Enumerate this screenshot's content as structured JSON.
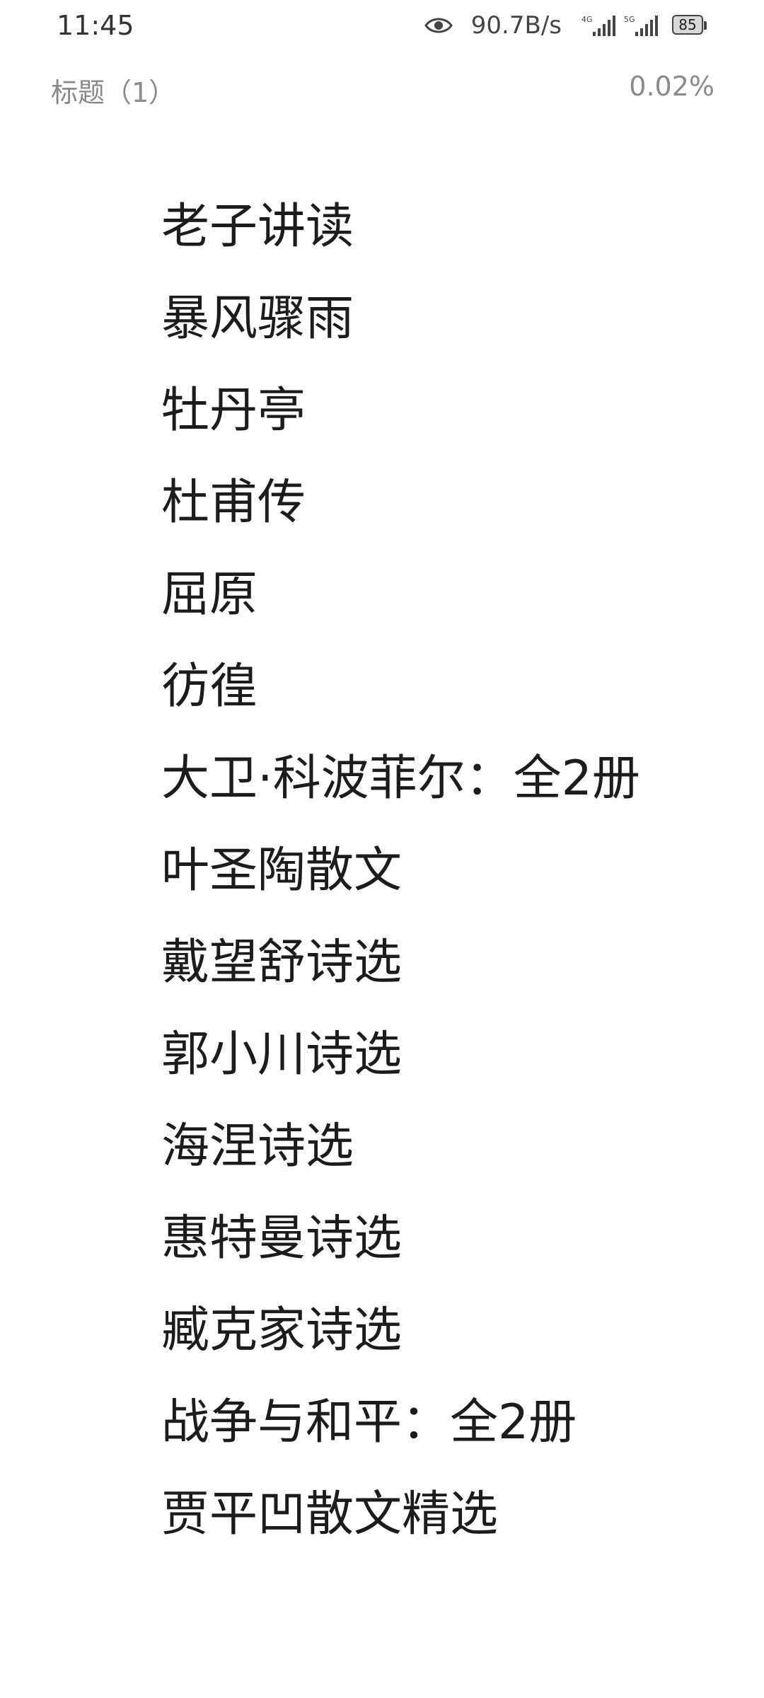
{
  "status_bar": {
    "time": "11:45",
    "net_speed": "90.7B/s",
    "signal_1": "4G",
    "signal_2": "5G",
    "battery": "85",
    "icons": [
      "eye-icon",
      "signal-4g-icon",
      "signal-5g-icon",
      "battery-icon"
    ]
  },
  "header": {
    "title": "标题（1）",
    "progress": "0.02%"
  },
  "toc": {
    "items": [
      {
        "label": "老子讲读"
      },
      {
        "label": "暴风骤雨"
      },
      {
        "label": "牡丹亭"
      },
      {
        "label": "杜甫传"
      },
      {
        "label": "屈原"
      },
      {
        "label": "彷徨"
      },
      {
        "label": "大卫·科波菲尔：全2册"
      },
      {
        "label": "叶圣陶散文"
      },
      {
        "label": "戴望舒诗选"
      },
      {
        "label": "郭小川诗选"
      },
      {
        "label": "海涅诗选"
      },
      {
        "label": "惠特曼诗选"
      },
      {
        "label": "臧克家诗选"
      },
      {
        "label": "战争与和平：全2册"
      },
      {
        "label": "贾平凹散文精选"
      }
    ]
  }
}
